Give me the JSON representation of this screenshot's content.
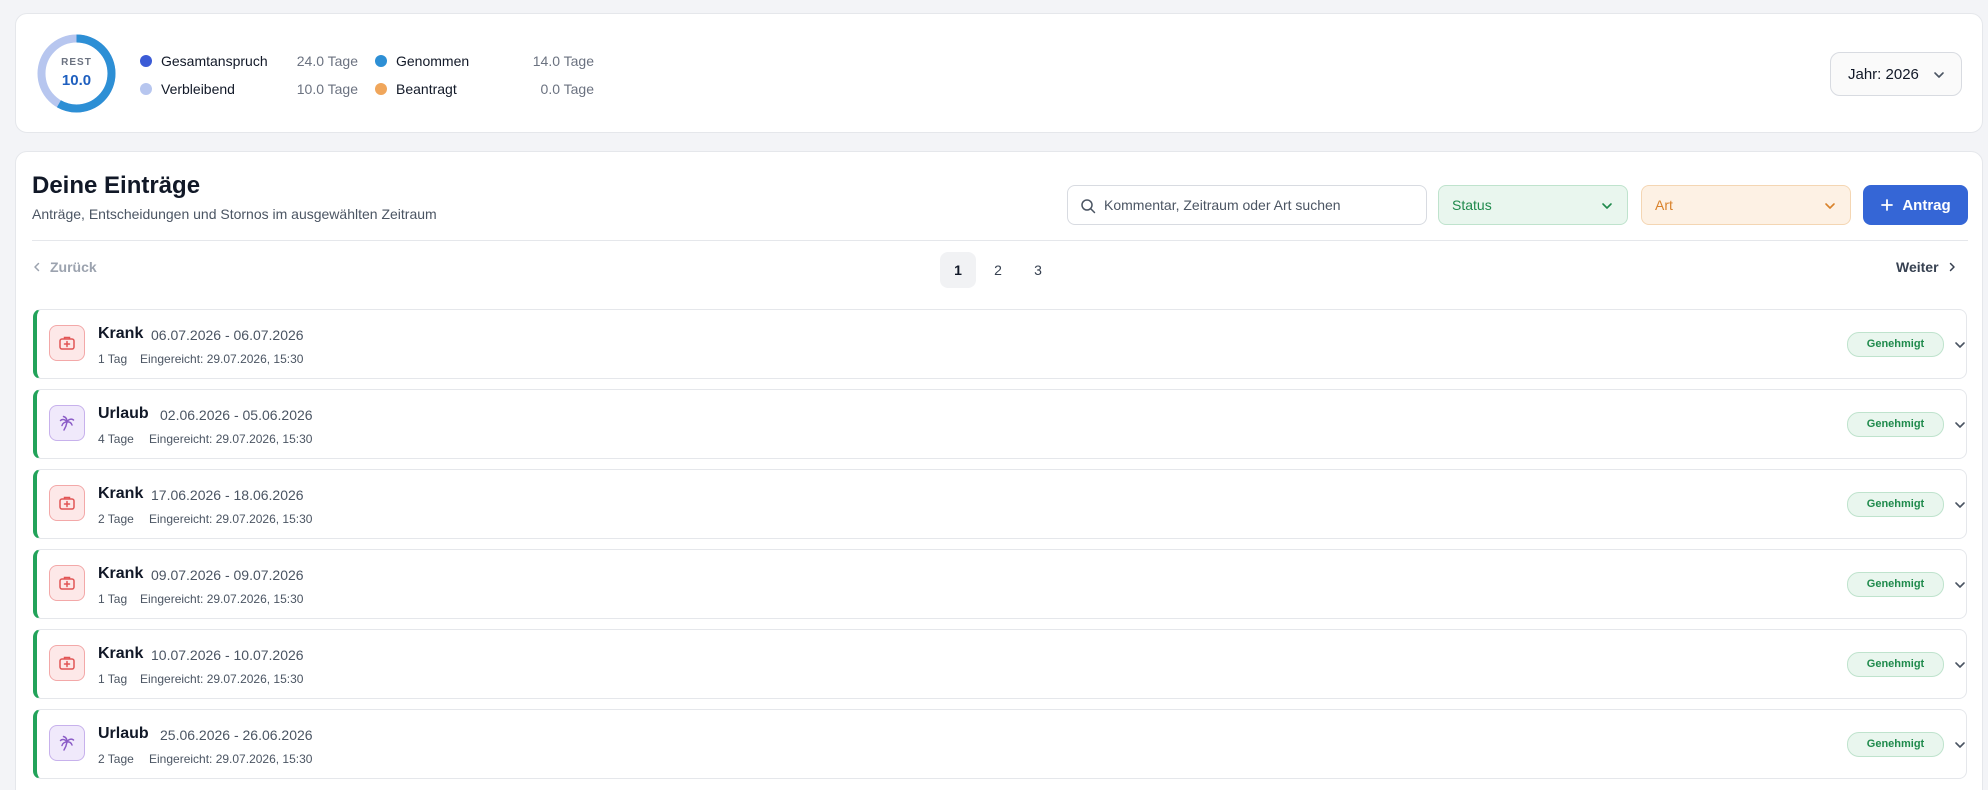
{
  "colors": {
    "primary": "#3566d6",
    "approved": "#22a35a",
    "taken": "#2d8fd5",
    "remaining": "#b7c6ef",
    "total": "#3b5bd6",
    "requested": "#f0a65b",
    "krank": "#e25555",
    "urlaub": "#8b5cc7"
  },
  "summary": {
    "ring": {
      "label": "REST",
      "value": "10.0",
      "taken_fraction": 0.583
    },
    "stats": [
      {
        "name": "Gesamtanspruch",
        "value": "24.0 Tage",
        "color": "#3b5bd6"
      },
      {
        "name": "Verbleibend",
        "value": "10.0 Tage",
        "color": "#b7c6ef"
      },
      {
        "name": "Genommen",
        "value": "14.0 Tage",
        "color": "#2d8fd5"
      },
      {
        "name": "Beantragt",
        "value": "0.0 Tage",
        "color": "#f0a65b"
      }
    ],
    "year_select": "Jahr: 2026"
  },
  "entries_section": {
    "title": "Deine Einträge",
    "subtitle": "Anträge, Entscheidungen und Stornos im ausgewählten Zeitraum",
    "search_placeholder": "Kommentar, Zeitraum oder Art suchen",
    "status_filter": "Status",
    "art_filter": "Art",
    "add_button": "Antrag"
  },
  "pagination": {
    "prev": "Zurück",
    "next": "Weiter",
    "pages": [
      "1",
      "2",
      "3"
    ],
    "current": "1"
  },
  "entries": [
    {
      "type": "Krank",
      "range": "06.07.2026 - 06.07.2026",
      "duration": "1 Tag",
      "submitted": "Eingereicht: 29.07.2026, 15:30",
      "status": "Genehmigt",
      "icon": "first-aid-kit-icon"
    },
    {
      "type": "Urlaub",
      "range": "02.06.2026 - 05.06.2026",
      "duration": "4 Tage",
      "submitted": "Eingereicht: 29.07.2026, 15:30",
      "status": "Genehmigt",
      "icon": "palm-tree-icon"
    },
    {
      "type": "Krank",
      "range": "17.06.2026 - 18.06.2026",
      "duration": "2 Tage",
      "submitted": "Eingereicht: 29.07.2026, 15:30",
      "status": "Genehmigt",
      "icon": "first-aid-kit-icon"
    },
    {
      "type": "Krank",
      "range": "09.07.2026 - 09.07.2026",
      "duration": "1 Tag",
      "submitted": "Eingereicht: 29.07.2026, 15:30",
      "status": "Genehmigt",
      "icon": "first-aid-kit-icon"
    },
    {
      "type": "Krank",
      "range": "10.07.2026 - 10.07.2026",
      "duration": "1 Tag",
      "submitted": "Eingereicht: 29.07.2026, 15:30",
      "status": "Genehmigt",
      "icon": "first-aid-kit-icon"
    },
    {
      "type": "Urlaub",
      "range": "25.06.2026 - 26.06.2026",
      "duration": "2 Tage",
      "submitted": "Eingereicht: 29.07.2026, 15:30",
      "status": "Genehmigt",
      "icon": "palm-tree-icon"
    }
  ]
}
